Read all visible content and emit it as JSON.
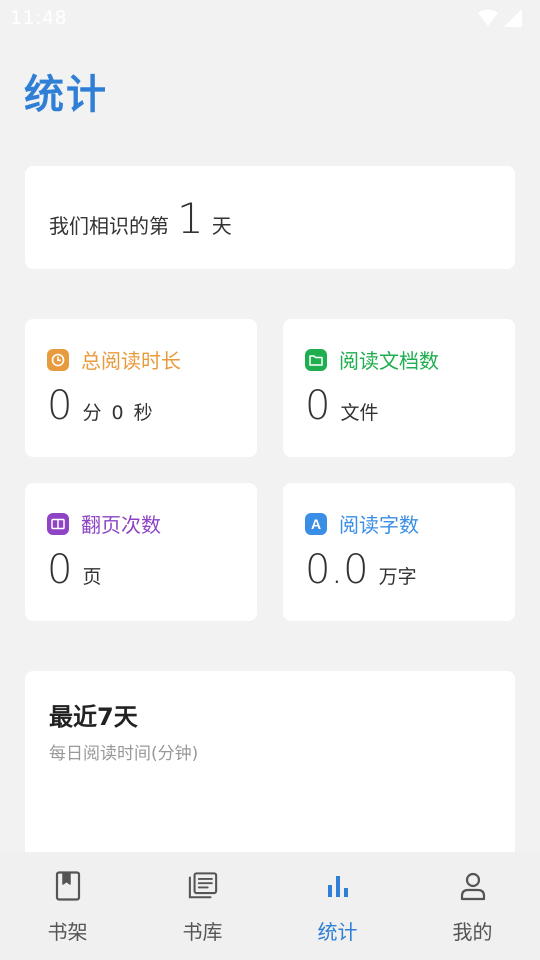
{
  "status_bar": {
    "time": "11:48"
  },
  "page": {
    "title": "统计"
  },
  "days": {
    "prefix": "我们相识的第",
    "count": "1",
    "suffix": "天"
  },
  "stats": {
    "reading_time": {
      "title": "总阅读时长",
      "value": "0",
      "unit_min": "分",
      "seconds": "0",
      "unit_sec": "秒",
      "color": "#e89b3c",
      "icon": "clock-icon"
    },
    "documents": {
      "title": "阅读文档数",
      "value": "0",
      "unit": "文件",
      "color": "#1fae4f",
      "icon": "folder-icon"
    },
    "page_turns": {
      "title": "翻页次数",
      "value": "0",
      "unit": "页",
      "color": "#8e44c4",
      "icon": "book-open-icon"
    },
    "word_count": {
      "title": "阅读字数",
      "value": "0.0",
      "unit": "万字",
      "color": "#3a8ee6",
      "icon": "letter-a-icon",
      "icon_letter": "A"
    }
  },
  "recent": {
    "title": "最近7天",
    "subtitle": "每日阅读时间(分钟)"
  },
  "nav": {
    "items": [
      {
        "label": "书架",
        "icon": "bookmark-book-icon"
      },
      {
        "label": "书库",
        "icon": "library-icon"
      },
      {
        "label": "统计",
        "icon": "bar-chart-icon",
        "active": true
      },
      {
        "label": "我的",
        "icon": "person-icon"
      }
    ]
  },
  "colors": {
    "accent": "#2f7fd6",
    "background": "#f2f2f2"
  }
}
